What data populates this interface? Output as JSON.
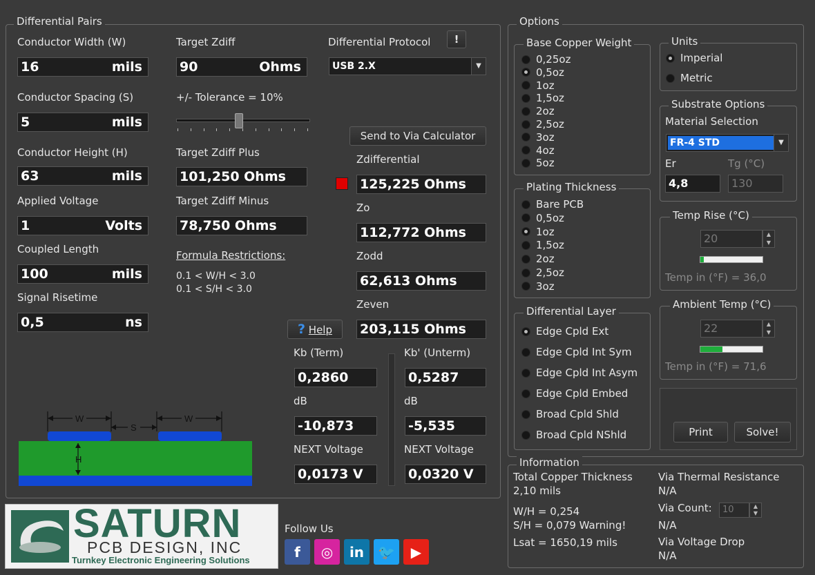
{
  "diff_pairs": {
    "title": "Differential Pairs",
    "conductor_width": {
      "label": "Conductor Width (W)",
      "value": "16",
      "unit": "mils"
    },
    "conductor_spacing": {
      "label": "Conductor Spacing (S)",
      "value": "5",
      "unit": "mils"
    },
    "conductor_height": {
      "label": "Conductor Height (H)",
      "value": "63",
      "unit": "mils"
    },
    "applied_voltage": {
      "label": "Applied Voltage",
      "value": "1",
      "unit": "Volts"
    },
    "coupled_length": {
      "label": "Coupled Length",
      "value": "100",
      "unit": "mils"
    },
    "signal_risetime": {
      "label": "Signal Risetime",
      "value": "0,5",
      "unit": "ns"
    },
    "target_zdiff": {
      "label": "Target Zdiff",
      "value": "90",
      "unit": "Ohms"
    },
    "tolerance": {
      "label": "+/- Tolerance = 10%",
      "percent": 10
    },
    "target_zdiff_plus": {
      "label": "Target Zdiff Plus",
      "value": "101,250 Ohms"
    },
    "target_zdiff_minus": {
      "label": "Target Zdiff Minus",
      "value": "78,750 Ohms"
    },
    "formula_restrictions": {
      "label": "Formula Restrictions:",
      "line1": "0.1 < W/H < 3.0",
      "line2": "0.1 < S/H < 3.0"
    },
    "protocol": {
      "label": "Differential Protocol",
      "info_button": "!",
      "value": "USB 2.X"
    },
    "send_to_via": "Send to Via Calculator",
    "zdifferential": {
      "label": "Zdifferential",
      "value": "125,225 Ohms",
      "status_color": "#e00000"
    },
    "zo": {
      "label": "Zo",
      "value": "112,772 Ohms"
    },
    "zodd": {
      "label": "Zodd",
      "value": "62,613 Ohms"
    },
    "zeven": {
      "label": "Zeven",
      "value": "203,115 Ohms"
    },
    "help": {
      "icon": "?",
      "label": "Help"
    },
    "kb_term": {
      "label": "Kb (Term)",
      "value": "0,2860",
      "db_label": "dB",
      "db_value": "-10,873",
      "next_label": "NEXT Voltage",
      "next_value": "0,0173 V"
    },
    "kb_unterm": {
      "label": "Kb' (Unterm)",
      "value": "0,5287",
      "db_label": "dB",
      "db_value": "-5,535",
      "next_label": "NEXT Voltage",
      "next_value": "0,0320 V"
    },
    "diagram": {
      "w_label": "W",
      "s_label": "S",
      "h_label": "H",
      "trace_color": "#1148d4",
      "dielectric_color": "#1f9a2c",
      "plane_color": "#1148d4"
    }
  },
  "options": {
    "title": "Options",
    "base_copper": {
      "title": "Base Copper Weight",
      "items": [
        "0,25oz",
        "0,5oz",
        "1oz",
        "1,5oz",
        "2oz",
        "2,5oz",
        "3oz",
        "4oz",
        "5oz"
      ],
      "selected": 1
    },
    "plating": {
      "title": "Plating Thickness",
      "items": [
        "Bare PCB",
        "0,5oz",
        "1oz",
        "1,5oz",
        "2oz",
        "2,5oz",
        "3oz"
      ],
      "selected": 2
    },
    "diff_layer": {
      "title": "Differential Layer",
      "items": [
        "Edge Cpld Ext",
        "Edge Cpld Int Sym",
        "Edge Cpld Int Asym",
        "Edge Cpld Embed",
        "Broad Cpld Shld",
        "Broad Cpld NShld"
      ],
      "selected": 0
    },
    "units": {
      "title": "Units",
      "items": [
        "Imperial",
        "Metric"
      ],
      "selected": 0
    },
    "substrate": {
      "title": "Substrate Options",
      "material_label": "Material Selection",
      "material": "FR-4 STD",
      "er_label": "Er",
      "er": "4,8",
      "tg_label": "Tg (°C)",
      "tg": "130"
    },
    "temp_rise": {
      "title": "Temp Rise (°C)",
      "value": "20",
      "level": 0.05,
      "f_label": "Temp in (°F) = 36,0"
    },
    "ambient": {
      "title": "Ambient Temp (°C)",
      "value": "22",
      "level": 0.35,
      "f_label": "Temp in (°F) = 71,6"
    },
    "print": "Print",
    "solve": "Solve!"
  },
  "information": {
    "title": "Information",
    "copper_thickness_label": "Total Copper Thickness",
    "copper_thickness": "2,10 mils",
    "wh": "W/H =  0,254",
    "sh": "S/H =   0,079 Warning!",
    "lsat": "Lsat =  1650,19 mils",
    "via_thermal_label": "Via Thermal Resistance",
    "via_thermal": "N/A",
    "via_count_label": "Via Count:",
    "via_count": "10",
    "via_count_result": "N/A",
    "via_drop_label": "Via Voltage Drop",
    "via_drop": "N/A"
  },
  "footer": {
    "logo_title": "SATURN",
    "logo_sub": "PCB DESIGN, INC",
    "logo_tag": "Turnkey Electronic Engineering Solutions",
    "follow": "Follow Us",
    "social": [
      {
        "icon": "facebook-icon",
        "glyph": "f",
        "color": "#3b5998"
      },
      {
        "icon": "instagram-icon",
        "glyph": "◎",
        "color": "#d6249f"
      },
      {
        "icon": "linkedin-icon",
        "glyph": "in",
        "color": "#0e76a8"
      },
      {
        "icon": "twitter-icon",
        "glyph": "🐦",
        "color": "#1da1f2"
      },
      {
        "icon": "youtube-icon",
        "glyph": "▶",
        "color": "#e62117"
      }
    ]
  }
}
